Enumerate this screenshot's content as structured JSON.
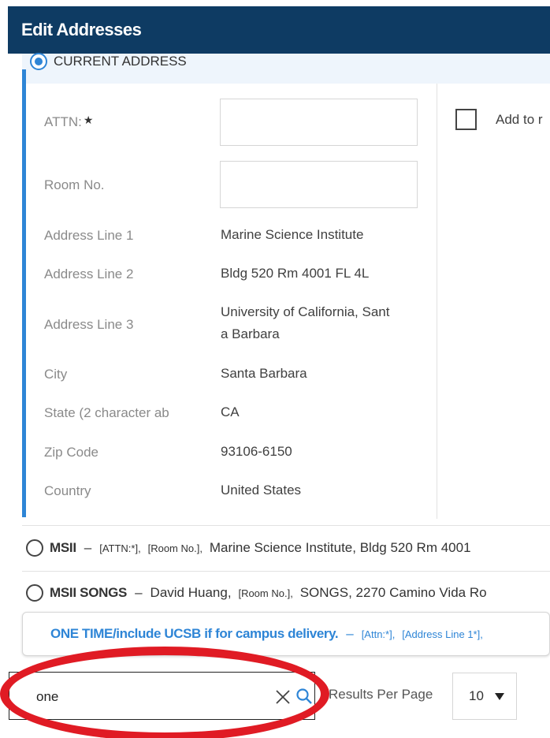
{
  "header": {
    "title": "Edit Addresses"
  },
  "current_address": {
    "label": "CURRENT ADDRESS",
    "fields": {
      "attn": {
        "label": "ATTN:",
        "required_mark": "★",
        "value": ""
      },
      "room_no": {
        "label": "Room No.",
        "value": ""
      },
      "address_line_1": {
        "label": "Address Line 1",
        "value": "Marine Science Institute"
      },
      "address_line_2": {
        "label": "Address Line 2",
        "value": "Bldg 520 Rm 4001 FL 4L"
      },
      "address_line_3": {
        "label": "Address Line 3",
        "value_line1": "University of California, Sant",
        "value_line2": "a Barbara"
      },
      "city": {
        "label": "City",
        "value": "Santa Barbara"
      },
      "state": {
        "label": "State (2 character ab",
        "value": "CA"
      },
      "zip": {
        "label": "Zip Code",
        "value": "93106-6150"
      },
      "country": {
        "label": "Country",
        "value": "United States"
      }
    },
    "add_to_label": "Add to r"
  },
  "address_options": [
    {
      "name": "MSII",
      "dash": "–",
      "attn": "[ATTN:*],",
      "room": "[Room No.],",
      "rest": "Marine Science Institute,  Bldg 520 Rm 4001"
    },
    {
      "name": "MSII SONGS",
      "dash": "–",
      "attn_value": "David Huang,",
      "room": "[Room No.],",
      "rest": "SONGS,  2270 Camino Vida Ro"
    }
  ],
  "one_time": {
    "title": "ONE TIME/include UCSB if for campus delivery.",
    "dash": "–",
    "attn": "[Attn:*],",
    "line1": "[Address Line 1*],"
  },
  "search": {
    "value": "one"
  },
  "results_per_page": {
    "label": "Results Per Page",
    "value": "10"
  },
  "colors": {
    "header_bg": "#0e3b63",
    "accent": "#2e85d6",
    "annotation": "#e01b24"
  }
}
